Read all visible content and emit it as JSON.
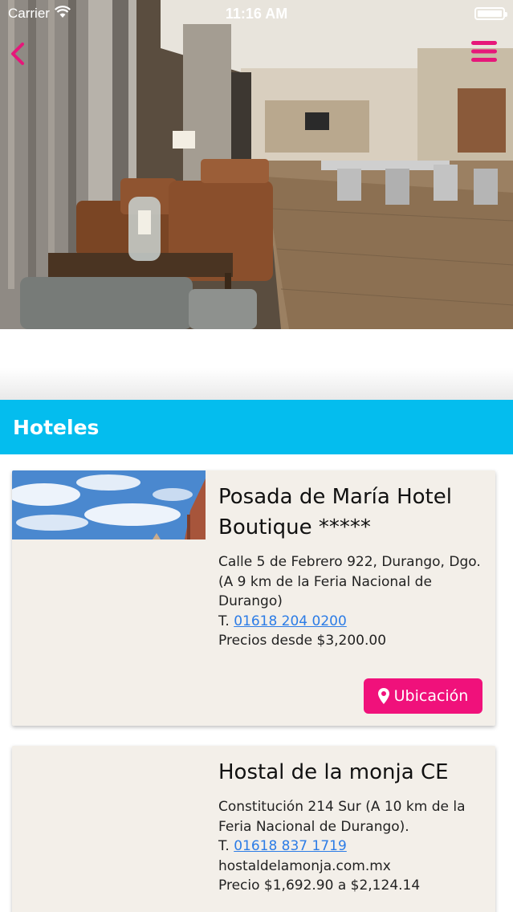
{
  "status_bar": {
    "carrier": "Carrier",
    "time": "11:16 AM"
  },
  "header": {
    "back_icon": "chevron-left-icon",
    "menu_icon": "hamburger-menu-icon",
    "accent_color": "#e6177a"
  },
  "section": {
    "title": "Hoteles",
    "color": "#04bdee"
  },
  "hotels": [
    {
      "name": "Posada de María Hotel Boutique *****",
      "address": "Calle 5 de Febrero 922, Durango, Dgo.",
      "distance": "(A 9 km de la Feria Nacional de Durango)",
      "phone_prefix": "T.",
      "phone": "01618 204 0200",
      "price": "Precios desde $3,200.00",
      "button_label": "Ubicación",
      "button_icon": "map-pin-icon",
      "button_color": "#f0117b"
    },
    {
      "name": "Hostal de la monja CE",
      "address": "Constitución 214 Sur (A 10 km de la Feria Nacional de Durango).",
      "phone_prefix": "T.",
      "phone": "01618 837 1719",
      "website": "hostaldelamonja.com.mx",
      "price": "Precio $1,692.90 a $2,124.14"
    }
  ]
}
